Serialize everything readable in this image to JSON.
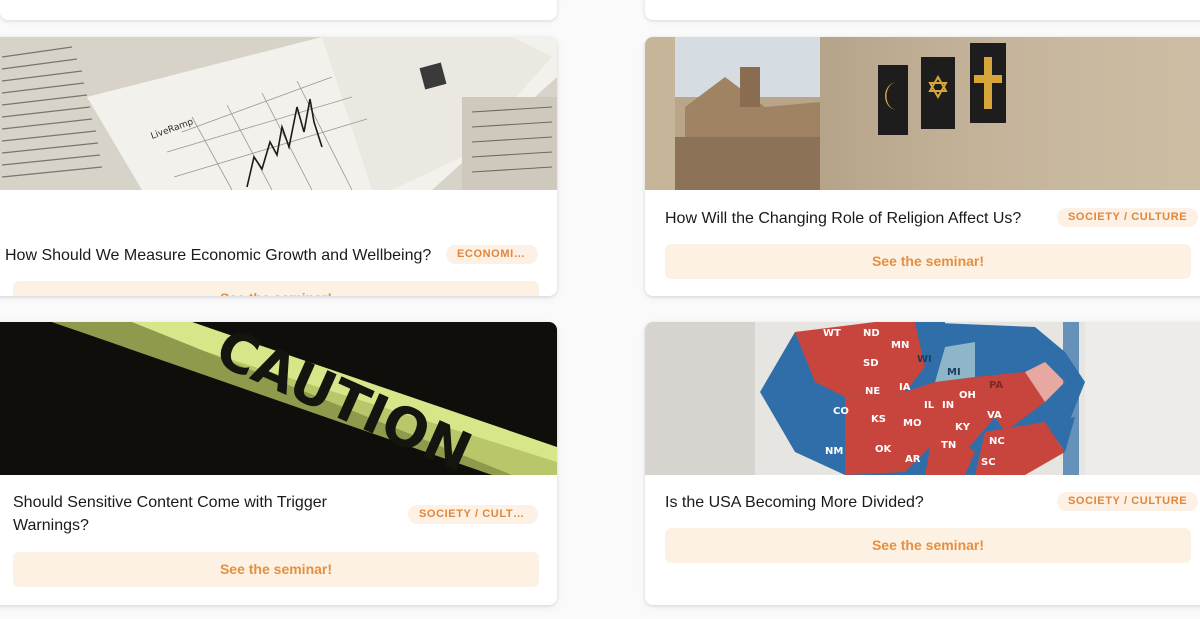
{
  "cards": [
    {
      "title": "How Should We Measure Economic Growth and Wellbeing?",
      "tag": "ECONOMICS",
      "cta": "See the seminar!",
      "image_label": "LiveRamp"
    },
    {
      "title": "How Will the Changing Role of Religion Affect Us?",
      "tag": "SOCIETY / CULTURE",
      "cta": "See the seminar!"
    },
    {
      "title": "Should Sensitive Content Come with Trigger Warnings?",
      "tag": "SOCIETY / CULTU...",
      "cta": "See the seminar!",
      "image_label": "CAUTION"
    },
    {
      "title": "Is the USA Becoming More Divided?",
      "tag": "SOCIETY / CULTURE",
      "cta": "See the seminar!",
      "map_states": [
        "WT",
        "ND",
        "MN",
        "SD",
        "WI",
        "MI",
        "NE",
        "IA",
        "CO",
        "KS",
        "MO",
        "IL",
        "IN",
        "OH",
        "PA",
        "OK",
        "AR",
        "TN",
        "KY",
        "NC",
        "SC",
        "VA",
        "NM"
      ]
    }
  ],
  "colors": {
    "accent_text": "#e58f42",
    "accent_bg": "#fdf1e3",
    "tag_text": "#e0873b",
    "tag_bg": "#fdf0e4",
    "red_state": "#c8453d",
    "blue_state": "#2f6ea8"
  }
}
